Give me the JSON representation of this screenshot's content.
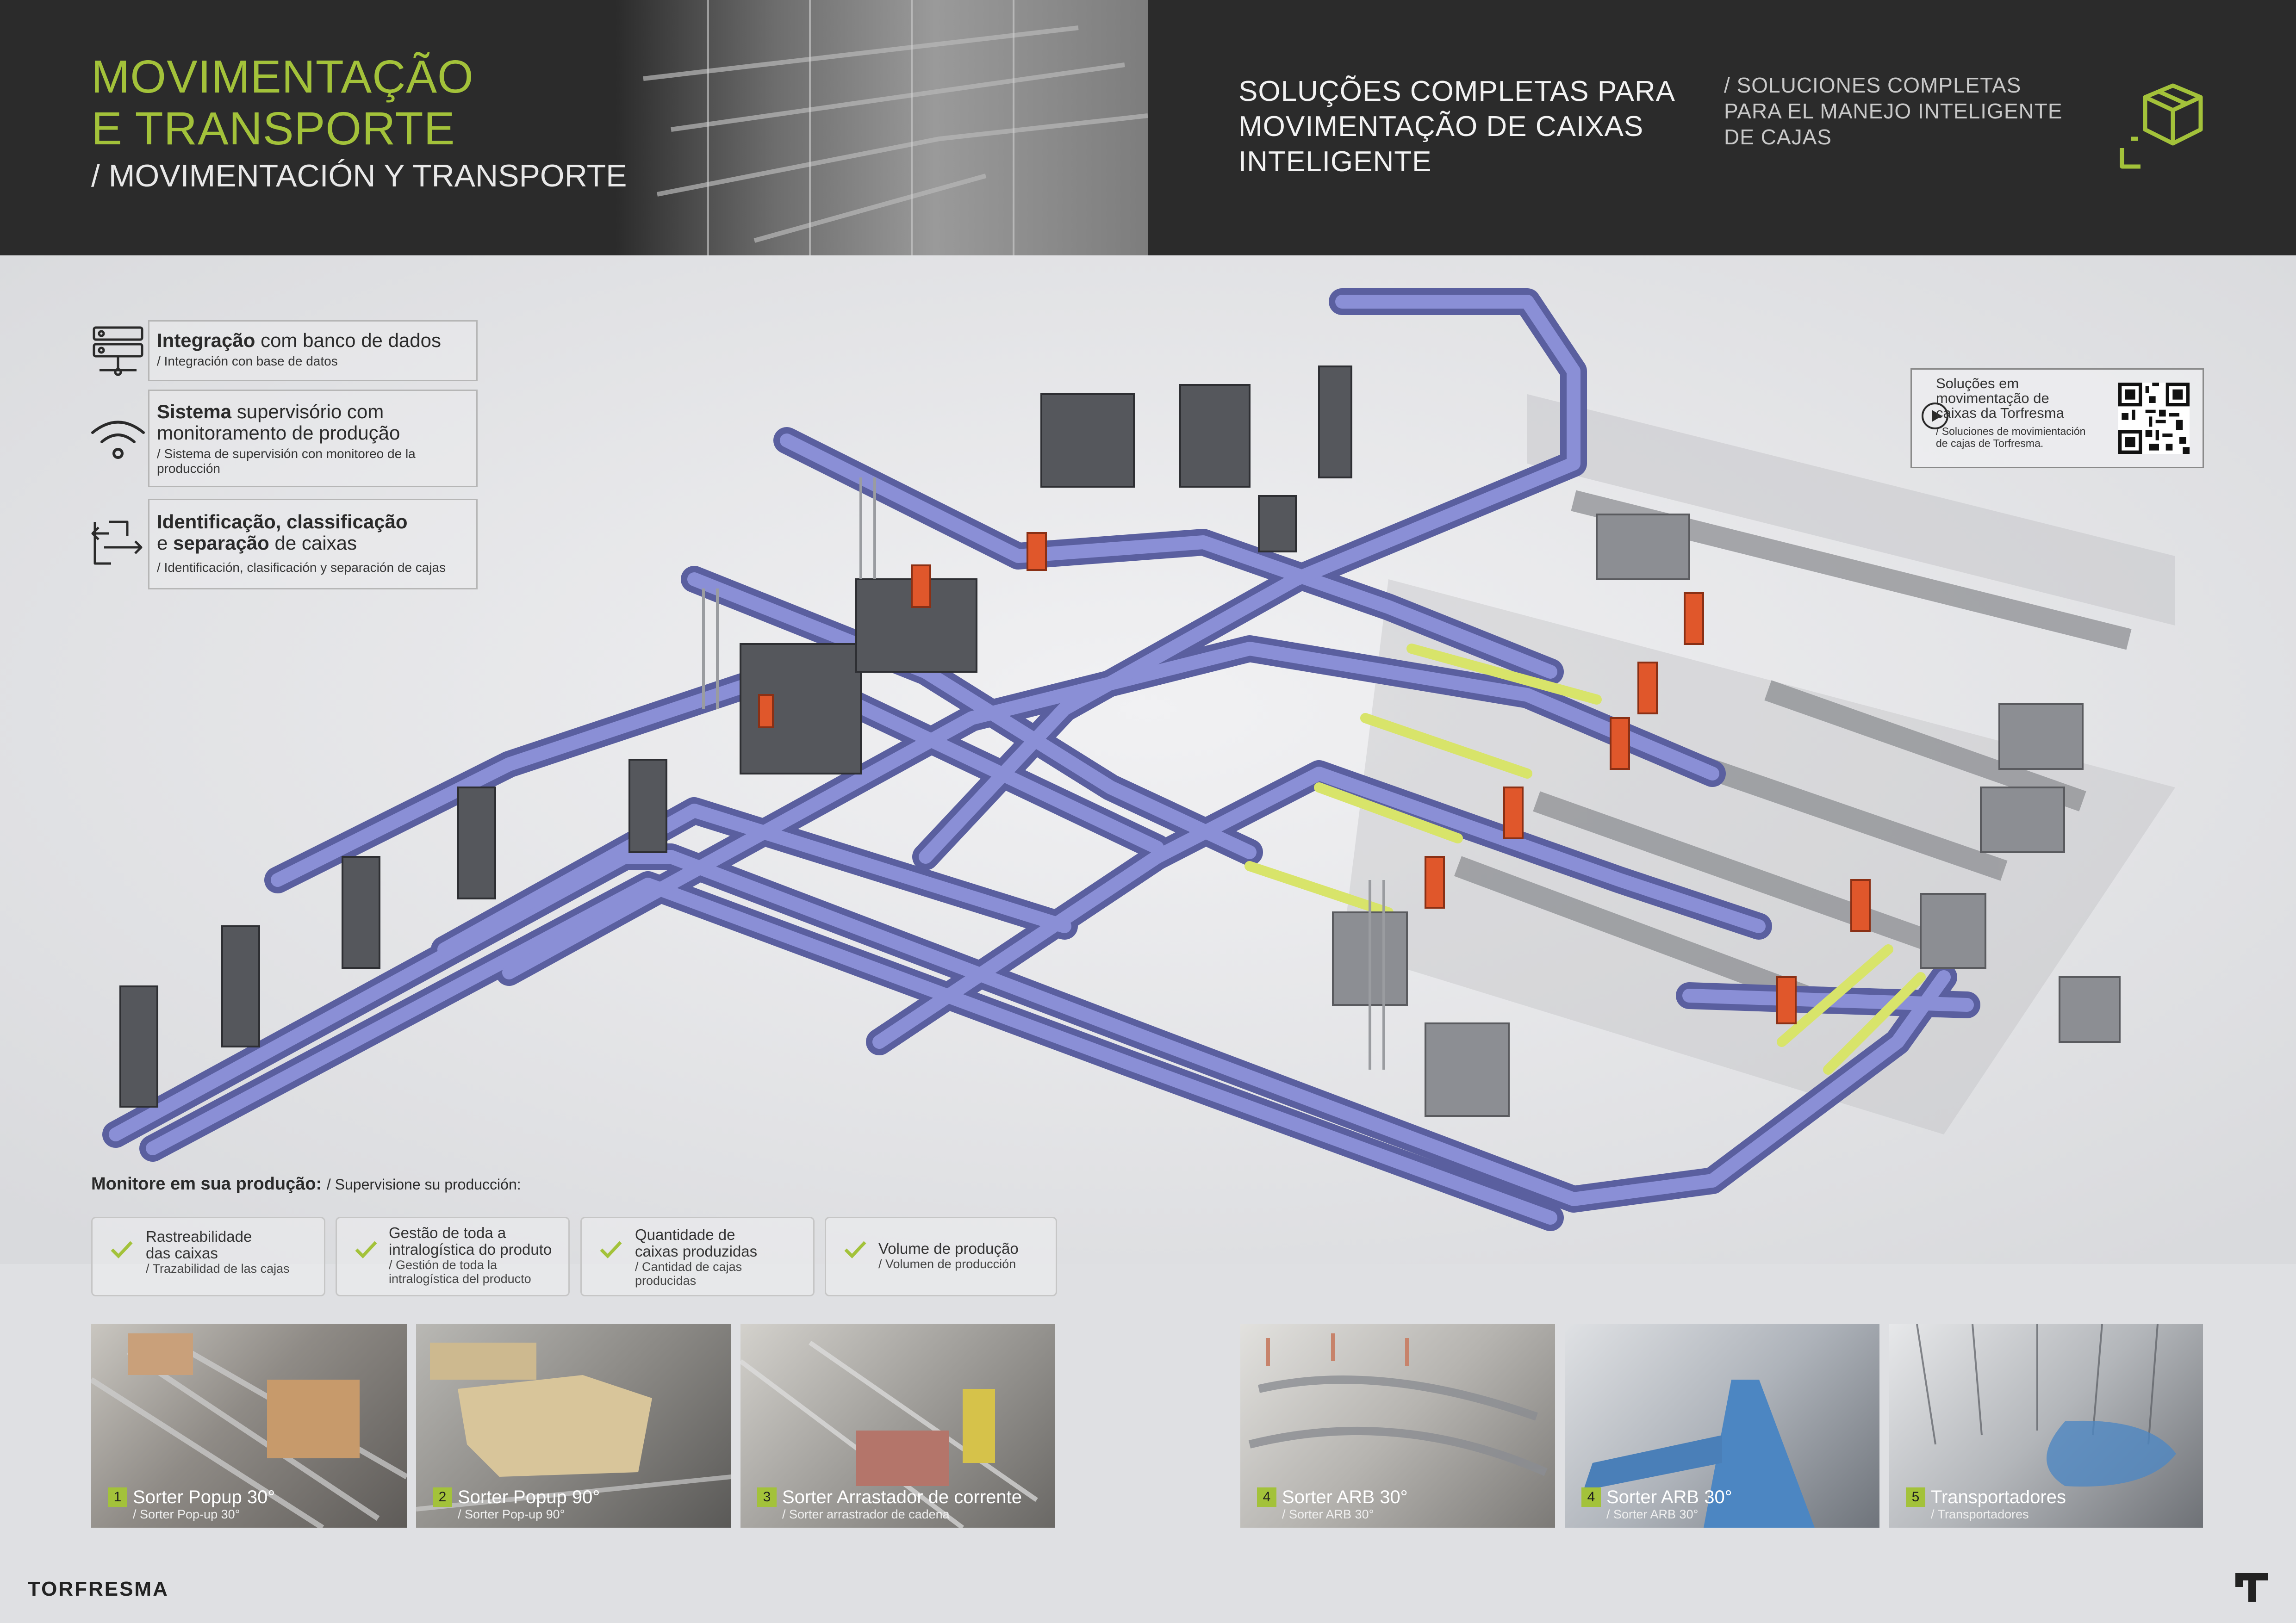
{
  "header": {
    "title_line1": "MOVIMENTAÇÃO",
    "title_line2": "E TRANSPORTE",
    "subtitle": "/ MOVIMENTACIÓN Y TRANSPORTE",
    "solutions_pt": [
      "SOLUÇÕES COMPLETAS PARA",
      "MOVIMENTAÇÃO DE CAIXAS",
      "INTELIGENTE"
    ],
    "solutions_es": [
      "/ SOLUCIONES COMPLETAS",
      "PARA EL MANEJO INTELIGENTE",
      "DE CAJAS"
    ],
    "icon": "box-cube-icon",
    "accent_color": "#a3c23a",
    "background_color": "#2b2b2b"
  },
  "features": [
    {
      "icon": "database-server-icon",
      "strong": "Integração",
      "rest": " com banco de dados",
      "es": "/ Integración con base de datos"
    },
    {
      "icon": "wireless-monitor-icon",
      "strong": "Sistema",
      "rest": " supervisório com monitoramento de produção",
      "es": "/ Sistema de supervisión con monitoreo de la producción"
    },
    {
      "icon": "sort-arrows-icon",
      "strong_a": "Identificação, classificação",
      "mid": "e ",
      "strong_b": "separação",
      "rest": " de caixas",
      "es": "/ Identificación, clasificación y separación de cajas"
    }
  ],
  "qr": {
    "text": [
      "Soluções em",
      "movimentação de",
      "caixas da Torfresma"
    ],
    "es": [
      "/ Soluciones de movimientación",
      "de cajas de Torfresma."
    ]
  },
  "monitor": {
    "title": "Monitore em sua produção:",
    "subtitle": "/ Supervisione su producción:",
    "items": [
      {
        "main": [
          "Rastreabilidade",
          "das caixas"
        ],
        "es": [
          "/ Trazabilidad de las cajas"
        ]
      },
      {
        "main": [
          "Gestão de toda a",
          "intralogística do produto"
        ],
        "es": [
          "/ Gestión de toda la",
          "intralogística del producto"
        ]
      },
      {
        "main": [
          "Quantidade de",
          "caixas produzidas"
        ],
        "es": [
          "/ Cantidad de cajas",
          "producidas"
        ]
      },
      {
        "main": [
          "Volume de produção"
        ],
        "es": [
          "/ Volumen de producción"
        ]
      }
    ]
  },
  "photos": [
    {
      "num": "1",
      "main": "Sorter Popup 30°",
      "es": "/ Sorter Pop-up 30°"
    },
    {
      "num": "2",
      "main": "Sorter Popup 90°",
      "es": "/ Sorter Pop-up 90°"
    },
    {
      "num": "3",
      "main": "Sorter Arrastador de corrente",
      "es": "/ Sorter arrastrador de cadena"
    },
    {
      "num": "4",
      "main": "Sorter ARB 30°",
      "es": "/ Sorter ARB 30°"
    },
    {
      "num": "4",
      "main": "Sorter ARB 30°",
      "es": "/ Sorter ARB 30°"
    },
    {
      "num": "5",
      "main": "Transportadores",
      "es": "/ Transportadores"
    }
  ],
  "footer": {
    "brand": "TORFRESMA",
    "logo_icon": "torfresma-t-logo-icon"
  }
}
